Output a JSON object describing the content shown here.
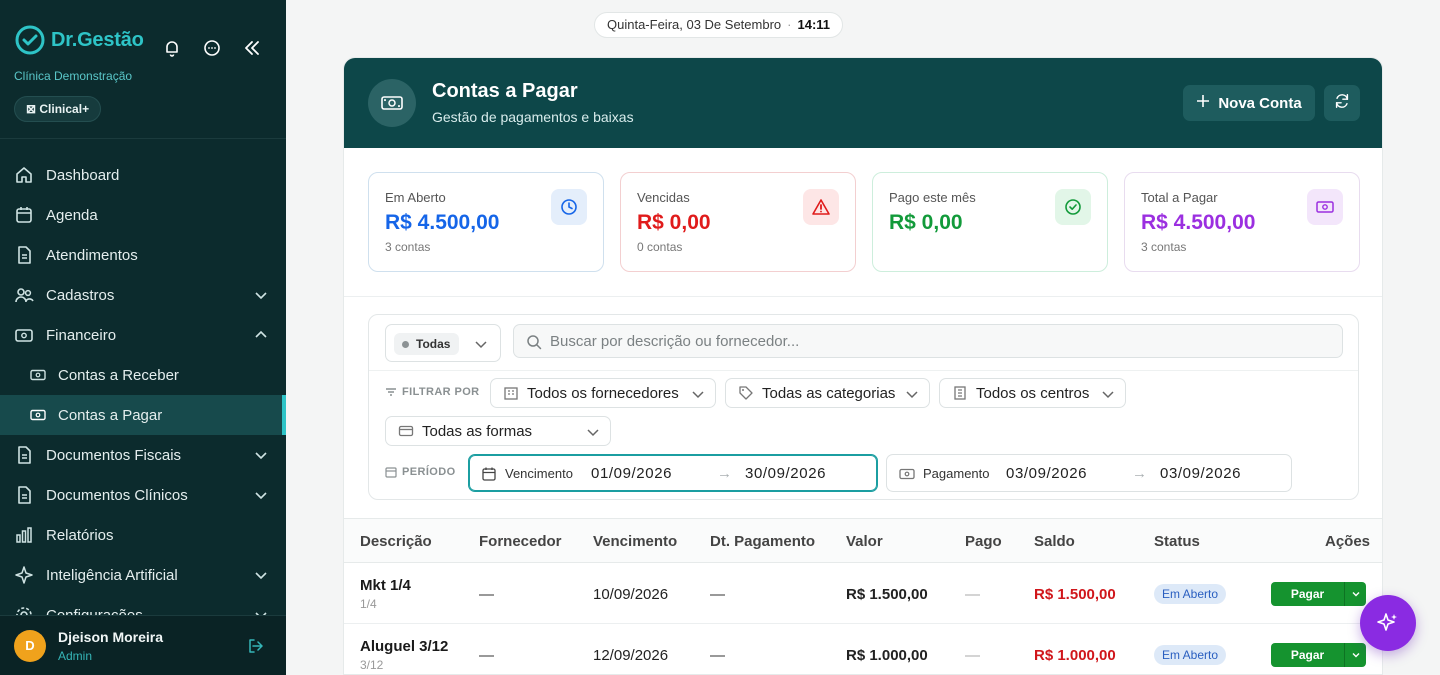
{
  "app": {
    "brand_name": "Dr.Gestão",
    "clinic_name": "Clínica Demonstração",
    "plan_badge": "⊠ Clinical+"
  },
  "sidebar": {
    "items": [
      {
        "label": "Dashboard",
        "icon": "home-icon"
      },
      {
        "label": "Agenda",
        "icon": "calendar-icon"
      },
      {
        "label": "Atendimentos",
        "icon": "document-icon"
      },
      {
        "label": "Cadastros",
        "icon": "users-icon"
      },
      {
        "label": "Financeiro",
        "icon": "money-icon"
      },
      {
        "label": "Contas a Receber",
        "icon": "banknote-icon"
      },
      {
        "label": "Contas a Pagar",
        "icon": "banknote-icon"
      },
      {
        "label": "Documentos Fiscais",
        "icon": "document-icon"
      },
      {
        "label": "Documentos Clínicos",
        "icon": "document-icon"
      },
      {
        "label": "Relatórios",
        "icon": "bar-chart-icon"
      },
      {
        "label": "Inteligência Artificial",
        "icon": "sparkle-icon"
      },
      {
        "label": "Configurações",
        "icon": "gear-icon"
      }
    ],
    "user": {
      "initial": "D",
      "name": "Djeison Moreira",
      "role": "Admin"
    }
  },
  "header": {
    "date": "Quinta-Feira, 03 De Setembro",
    "separator": "·",
    "time": "14:11"
  },
  "page": {
    "title": "Contas a Pagar",
    "subtitle": "Gestão de pagamentos e baixas",
    "new_button": "Nova Conta"
  },
  "stats": [
    {
      "label": "Em Aberto",
      "value": "R$ 4.500,00",
      "count": "3 contas",
      "color": "#1565e8"
    },
    {
      "label": "Vencidas",
      "value": "R$ 0,00",
      "count": "0 contas",
      "color": "#e01b1b"
    },
    {
      "label": "Pago este mês",
      "value": "R$ 0,00",
      "count": "",
      "color": "#129a3a"
    },
    {
      "label": "Total a Pagar",
      "value": "R$ 4.500,00",
      "count": "3 contas",
      "color": "#9b2fe0"
    }
  ],
  "filters": {
    "status_value": "Todas",
    "search_placeholder": "Buscar por descrição ou fornecedor...",
    "filter_label": "FILTRAR POR",
    "supplier": "Todos os fornecedores",
    "category": "Todas as categorias",
    "center": "Todos os centros",
    "payment_form": "Todas as formas",
    "period_label": "PERÍODO",
    "due": {
      "label": "Vencimento",
      "from": "01/09/2026",
      "to": "30/09/2026"
    },
    "payment": {
      "label": "Pagamento",
      "from": "03/09/2026",
      "to": "03/09/2026"
    },
    "arrow": "→"
  },
  "table": {
    "columns": [
      "Descrição",
      "Fornecedor",
      "Vencimento",
      "Dt. Pagamento",
      "Valor",
      "Pago",
      "Saldo",
      "Status",
      "Ações"
    ],
    "rows": [
      {
        "desc": "Mkt 1/4",
        "sub": "1/4",
        "supplier": "—",
        "due": "10/09/2026",
        "paid_date": "—",
        "value": "R$ 1.500,00",
        "paid": "—",
        "balance": "R$ 1.500,00",
        "status": "Em Aberto",
        "action": "Pagar"
      },
      {
        "desc": "Aluguel 3/12",
        "sub": "3/12",
        "supplier": "—",
        "due": "12/09/2026",
        "paid_date": "—",
        "value": "R$ 1.000,00",
        "paid": "—",
        "balance": "R$ 1.000,00",
        "status": "Em Aberto",
        "action": "Pagar"
      }
    ]
  }
}
